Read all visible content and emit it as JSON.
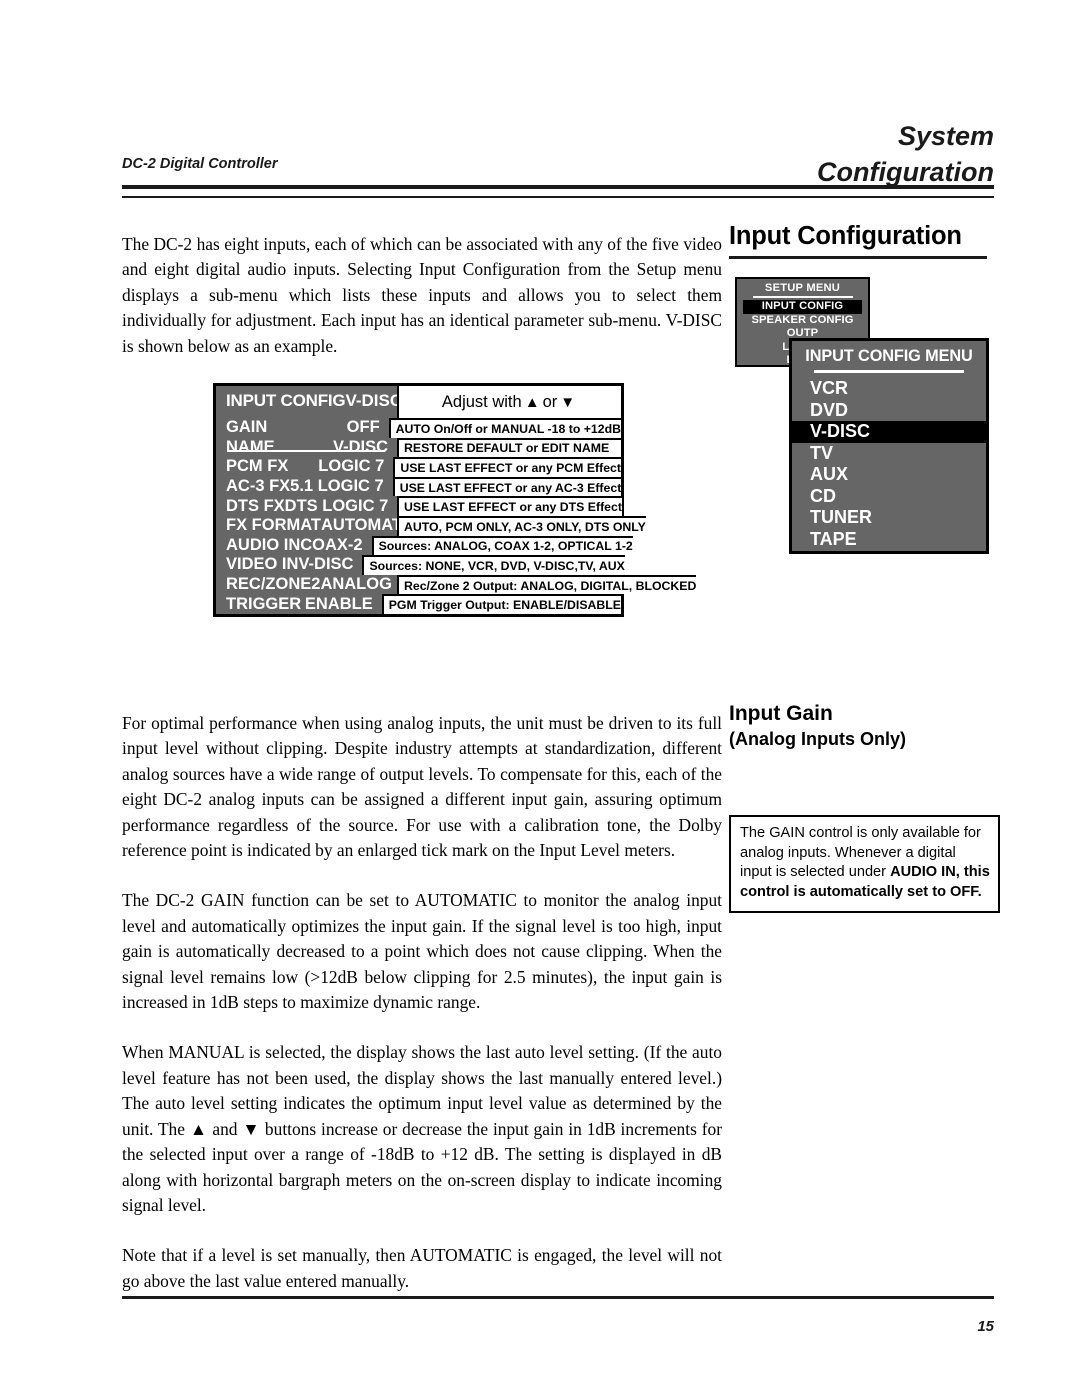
{
  "header": {
    "title_line1": "System",
    "title_line2": "Configuration",
    "product": "DC-2 Digital Controller"
  },
  "footer": {
    "page_number": "15"
  },
  "body": {
    "paragraph_1": "The DC-2 has eight inputs, each of which can be associated with any of the five video and eight digital audio inputs. Selecting Input Configuration from the Setup menu displays a sub-menu which lists these inputs and allows you to select them individually for adjustment. Each input has an identical parameter sub-menu. V-DISC is shown below as an example.",
    "paragraph_2": "For optimal performance when using analog inputs, the unit must be driven to its full input level without clipping. Despite industry attempts at standardization, different analog sources have a wide range of output levels. To compensate for this, each of the eight DC-2 analog inputs can be assigned a different input gain, assuring optimum performance regardless of the source. For use with a calibration tone, the Dolby reference point is indicated by an enlarged tick mark on the Input Level meters.",
    "paragraph_3": "The DC-2 GAIN function can be set to AUTOMATIC to monitor the analog input level and automatically optimizes the input gain. If the signal level is too high, input gain is automatically decreased to a point which does not cause clipping. When the signal level remains low (>12dB below clipping for 2.5 minutes), the input gain is increased in 1dB steps to maximize dynamic range.",
    "paragraph_4": "When MANUAL is selected, the display shows the last auto level setting. (If the auto level feature has not been used, the display shows the last manually entered level.) The auto level setting indicates the optimum input level value as determined by the unit. The ▲ and ▼ buttons increase or decrease the input gain in 1dB increments for the selected input over a range of -18dB to +12 dB.  The setting is displayed in dB along with horizontal bargraph meters on the on-screen display to indicate incoming signal level.",
    "paragraph_5": "Note that if a level is set manually, then AUTOMATIC is engaged, the level will not go above the last value entered manually."
  },
  "right_column": {
    "input_configuration_heading": "Input Configuration",
    "input_gain_heading": "Input Gain",
    "input_gain_subheading": "(Analog Inputs Only)",
    "note": {
      "text_normal_1": "The GAIN control is only available for analog inputs. Whenever a digital input is selected under ",
      "text_bold_1": "AUDIO IN, this control is automatically set to OFF."
    }
  },
  "config_table": {
    "title": "INPUT CONFIG",
    "selected_input": "V-DISC",
    "adjust_prefix": "Adjust with",
    "adjust_up_icon": "▲",
    "adjust_or": "or",
    "adjust_down_icon": "▼",
    "rows": [
      {
        "name": "GAIN",
        "value": "OFF",
        "description": "AUTO On/Off or MANUAL -18 to +12dB"
      },
      {
        "name": "NAME",
        "value": "V-DISC",
        "description": "RESTORE DEFAULT or EDIT NAME"
      },
      {
        "name": "PCM FX",
        "value": "LOGIC 7",
        "description": "USE LAST EFFECT or any PCM Effect"
      },
      {
        "name": "AC-3 FX",
        "value": "5.1 LOGIC 7",
        "description": "USE LAST EFFECT or any AC-3 Effect"
      },
      {
        "name": "DTS FX",
        "value": "DTS LOGIC 7",
        "description": "USE LAST EFFECT or any DTS Effect"
      },
      {
        "name": "FX FORMAT",
        "value": "AUTOMATIC",
        "description": "AUTO, PCM ONLY, AC-3 ONLY, DTS ONLY"
      },
      {
        "name": "AUDIO IN",
        "value": "COAX-2",
        "description": "Sources: ANALOG, COAX 1-2, OPTICAL 1-2"
      },
      {
        "name": "VIDEO IN",
        "value": "V-DISC",
        "description": "Sources: NONE, VCR, DVD, V-DISC,TV, AUX"
      },
      {
        "name": "REC/ZONE2",
        "value": "ANALOG",
        "description": "Rec/Zone 2 Output: ANALOG, DIGITAL, BLOCKED"
      },
      {
        "name": "TRIGGER",
        "value": "ENABLE",
        "description": "PGM Trigger Output: ENABLE/DISABLE"
      }
    ]
  },
  "setup_menu": {
    "title": "SETUP MENU",
    "items": [
      {
        "label": "INPUT CONFIG",
        "selected": true
      },
      {
        "label": "SPEAKER CONFIG",
        "selected": false
      },
      {
        "label": "OUTP",
        "selected": false
      },
      {
        "label": "LISTEN",
        "selected": false
      },
      {
        "label": "LOCK",
        "selected": false
      }
    ]
  },
  "input_config_menu": {
    "title": "INPUT CONFIG MENU",
    "items": [
      {
        "label": "VCR",
        "selected": false
      },
      {
        "label": "DVD",
        "selected": false
      },
      {
        "label": "V-DISC",
        "selected": true
      },
      {
        "label": "TV",
        "selected": false
      },
      {
        "label": "AUX",
        "selected": false
      },
      {
        "label": "CD",
        "selected": false
      },
      {
        "label": "TUNER",
        "selected": false
      },
      {
        "label": "TAPE",
        "selected": false
      }
    ]
  },
  "colors": {
    "osd_background": "#666666",
    "osd_highlight": "#000000",
    "osd_text": "#ffffff",
    "rule": "#1a1a1a"
  }
}
